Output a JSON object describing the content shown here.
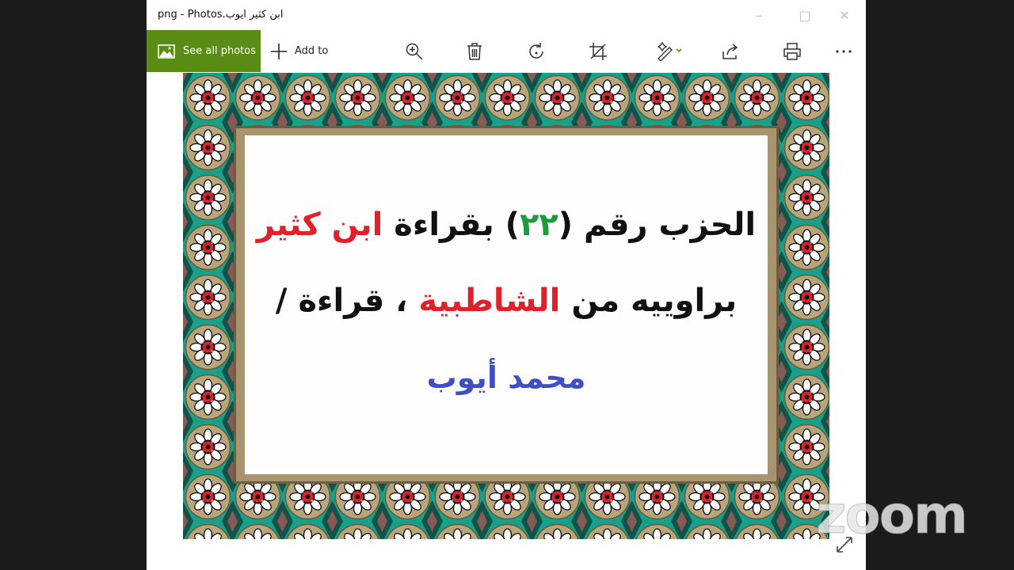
{
  "window": {
    "title": "ابن كثير ايوب.png - Photos"
  },
  "toolbar": {
    "see_all_label": "See all photos",
    "add_to_label": "Add to",
    "icons": [
      "zoom-in-icon",
      "delete-icon",
      "rotate-icon",
      "crop-icon",
      "edit-icon",
      "share-icon",
      "print-icon",
      "more-icon"
    ]
  },
  "photo": {
    "line1": {
      "part1": "الحزب رقم (",
      "number": "٢٢",
      "part2": ") بقراءة ",
      "highlight": "ابن كثير"
    },
    "line2": {
      "part1": "براوييه  من ",
      "highlight": "الشاطبية",
      "part2": " ، قراءة /"
    },
    "line3": "محمد أيوب",
    "colors": {
      "black": "#111111",
      "red": "#e0202a",
      "green": "#1e9b3c",
      "blue": "#3e4fc4",
      "teal": "#17a08a",
      "gold": "#a8946e"
    }
  },
  "overlay": {
    "zoom_logo": "zoom"
  }
}
